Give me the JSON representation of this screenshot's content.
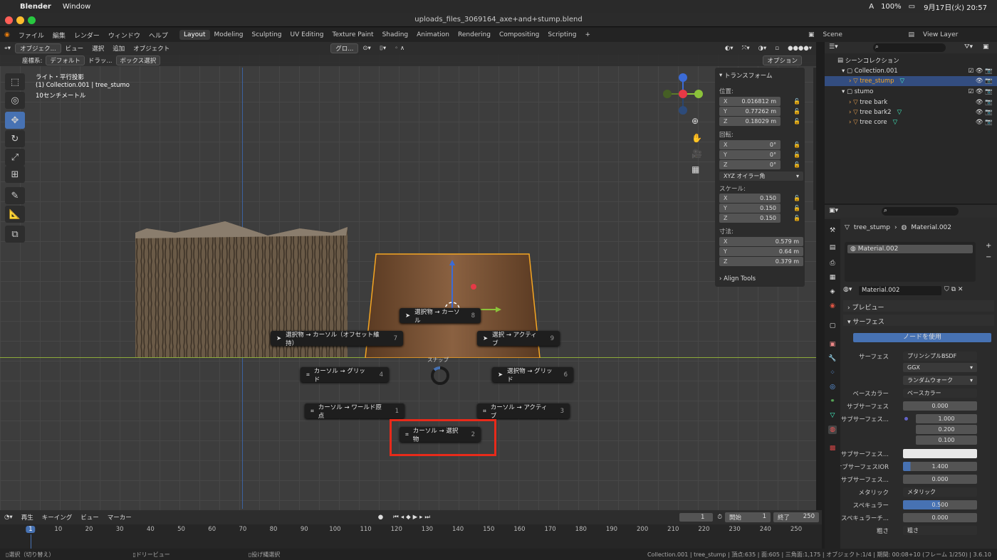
{
  "mac": {
    "app": "Blender",
    "menu": "Window",
    "battery": "100%",
    "datetime": "9月17日(火) 20:57",
    "input": "A"
  },
  "window": {
    "title": "uploads_files_3069164_axe+and+stump.blend"
  },
  "menus": [
    "ファイル",
    "編集",
    "レンダー",
    "ウィンドウ",
    "ヘルプ"
  ],
  "workspaces": [
    "Layout",
    "Modeling",
    "Sculpting",
    "UV Editing",
    "Texture Paint",
    "Shading",
    "Animation",
    "Rendering",
    "Compositing",
    "Scripting"
  ],
  "scene": {
    "name": "Scene",
    "view_layer": "View Layer"
  },
  "viewport": {
    "header": {
      "mode": "オブジェク...",
      "view": "ビュー",
      "select": "選択",
      "add": "追加",
      "object": "オブジェクト",
      "orientation": "グロ..."
    },
    "header2": {
      "coord": "座標系:",
      "orient": "デフォルト",
      "drag": "ドラッ...",
      "select_box": "ボックス選択",
      "options": "オプション"
    },
    "info": {
      "line1": "ライト・平行投影",
      "line2": "(1) Collection.001 | tree_stumo",
      "line3": "10センチメートル"
    }
  },
  "pie": {
    "title": "スナップ",
    "items": [
      {
        "label": "選択物 → カーソル",
        "key": "8"
      },
      {
        "label": "選択物 → カーソル（オフセット維持）",
        "key": "7"
      },
      {
        "label": "選択 → アクティブ",
        "key": "9"
      },
      {
        "label": "カーソル → グリッド",
        "key": "4"
      },
      {
        "label": "選択物 → グリッド",
        "key": "6"
      },
      {
        "label": "カーソル → ワールド原点",
        "key": "1"
      },
      {
        "label": "カーソル → アクティブ",
        "key": "3"
      },
      {
        "label": "カーソル → 選択物",
        "key": "2"
      }
    ]
  },
  "npanel": {
    "title": "トランスフォーム",
    "location_label": "位置:",
    "loc": {
      "x": "0.016812 m",
      "y": "0.77262 m",
      "z": "0.18029 m"
    },
    "rotation_label": "回転:",
    "rot": {
      "x": "0°",
      "y": "0°",
      "z": "0°"
    },
    "rot_mode": "XYZ オイラー角",
    "scale_label": "スケール:",
    "scale": {
      "x": "0.150",
      "y": "0.150",
      "z": "0.150"
    },
    "dim_label": "寸法:",
    "dim": {
      "x": "0.579 m",
      "y": "0.64 m",
      "z": "0.379 m"
    },
    "align": "Align Tools",
    "axes": {
      "x": "X",
      "y": "Y",
      "z": "Z"
    }
  },
  "outliner": {
    "items": [
      {
        "label": "シーンコレクション",
        "level": 0
      },
      {
        "label": "Collection.001",
        "level": 1
      },
      {
        "label": "tree_stump",
        "level": 2,
        "selected": true
      },
      {
        "label": "stumo",
        "level": 1
      },
      {
        "label": "tree bark",
        "level": 2
      },
      {
        "label": "tree bark2",
        "level": 2
      },
      {
        "label": "tree core",
        "level": 2
      }
    ]
  },
  "props": {
    "breadcrumb_obj": "tree_stump",
    "breadcrumb_mat": "Material.002",
    "slot": "Material.002",
    "material": "Material.002",
    "preview": "プレビュー",
    "surface_section": "サーフェス",
    "use_nodes": "ノードを使用",
    "rows": [
      {
        "label": "サーフェス",
        "value": "プリンシプルBSDF"
      },
      {
        "label": "",
        "value": "GGX"
      },
      {
        "label": "",
        "value": "ランダムウォーク"
      },
      {
        "label": "ベースカラー",
        "value": "ベースカラー"
      },
      {
        "label": "サブサーフェス",
        "value": "0.000"
      },
      {
        "label": "サブサーフェス...",
        "value": "1.000"
      },
      {
        "label": "",
        "value": "0.200"
      },
      {
        "label": "",
        "value": "0.100"
      },
      {
        "label": "サブサーフェス...",
        "value": ""
      },
      {
        "label": "サブサーフェスIOR",
        "value": "1.400"
      },
      {
        "label": "サブサーフェス...",
        "value": "0.000"
      },
      {
        "label": "メタリック",
        "value": "メタリック"
      },
      {
        "label": "スペキュラー",
        "value": "0.500"
      },
      {
        "label": "スペキュラーチ...",
        "value": "0.000"
      },
      {
        "label": "粗さ",
        "value": "粗さ"
      }
    ]
  },
  "timeline": {
    "play": "再生",
    "keying": "キーイング",
    "view": "ビュー",
    "marker": "マーカー",
    "current": "1",
    "start_label": "開始",
    "start": "1",
    "end_label": "終了",
    "end": "250",
    "ticks": [
      "1",
      "10",
      "20",
      "30",
      "40",
      "50",
      "60",
      "70",
      "80",
      "90",
      "100",
      "110",
      "120",
      "130",
      "140",
      "150",
      "160",
      "170",
      "180",
      "190",
      "200",
      "210",
      "220",
      "230",
      "240",
      "250"
    ]
  },
  "status": {
    "left": "選択（切り替え）",
    "mid": "ドリービュー",
    "mid2": "投げ縄選択",
    "right": "Collection.001 | tree_stump | 頂点:635 | 面:605 | 三角面:1,175 | オブジェクト:1/4 | 期間: 00:08+10 (フレーム 1/250) | 3.6.10"
  }
}
